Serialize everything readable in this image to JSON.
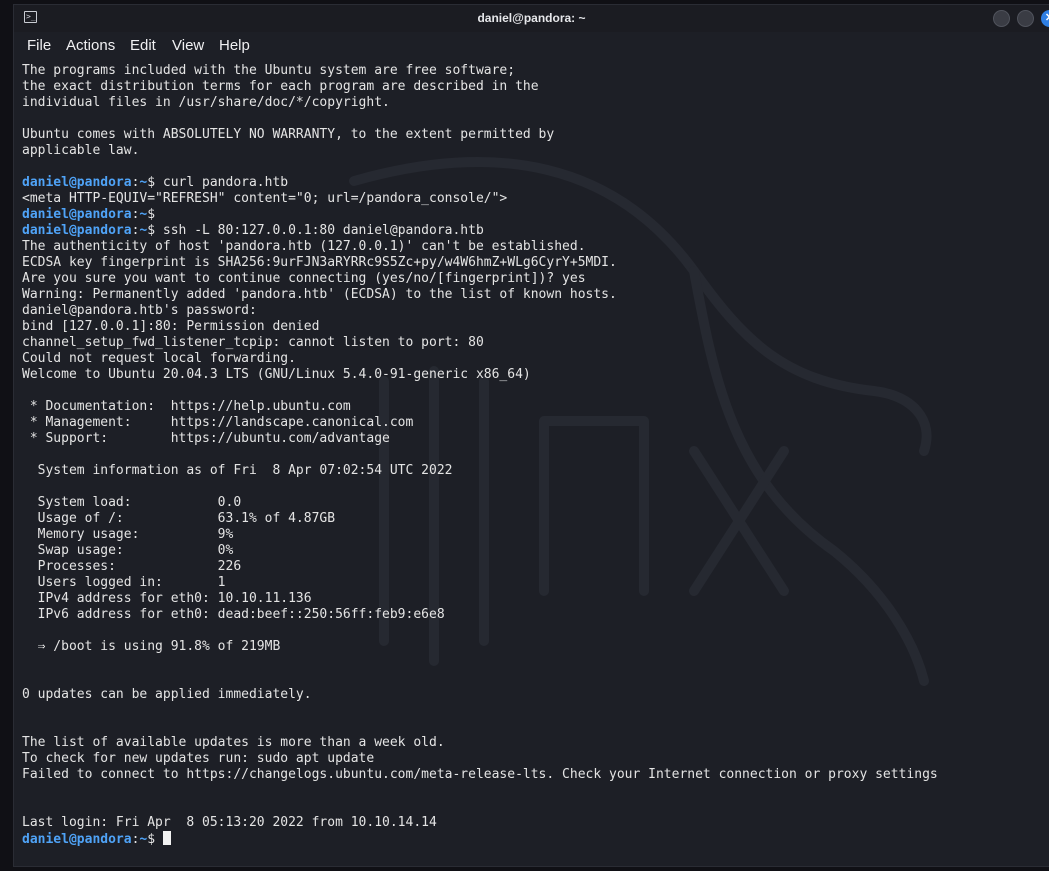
{
  "window": {
    "title": "daniel@pandora: ~",
    "app_icon": "terminal-icon",
    "close_glyph": "✕"
  },
  "menu": [
    "File",
    "Actions",
    "Edit",
    "View",
    "Help"
  ],
  "prompt": {
    "user_host": "daniel@pandora",
    "separator": ":",
    "path": "~",
    "symbol": "$"
  },
  "terminal_lines": [
    {
      "type": "text",
      "text": "The programs included with the Ubuntu system are free software;"
    },
    {
      "type": "text",
      "text": "the exact distribution terms for each program are described in the"
    },
    {
      "type": "text",
      "text": "individual files in /usr/share/doc/*/copyright."
    },
    {
      "type": "text",
      "text": ""
    },
    {
      "type": "text",
      "text": "Ubuntu comes with ABSOLUTELY NO WARRANTY, to the extent permitted by"
    },
    {
      "type": "text",
      "text": "applicable law."
    },
    {
      "type": "text",
      "text": ""
    },
    {
      "type": "cmd",
      "text": " curl pandora.htb"
    },
    {
      "type": "text",
      "text": "<meta HTTP-EQUIV=\"REFRESH\" content=\"0; url=/pandora_console/\">"
    },
    {
      "type": "cmd",
      "text": ""
    },
    {
      "type": "cmd",
      "text": " ssh -L 80:127.0.0.1:80 daniel@pandora.htb"
    },
    {
      "type": "text",
      "text": "The authenticity of host 'pandora.htb (127.0.0.1)' can't be established."
    },
    {
      "type": "text",
      "text": "ECDSA key fingerprint is SHA256:9urFJN3aRYRRc9S5Zc+py/w4W6hmZ+WLg6CyrY+5MDI."
    },
    {
      "type": "text",
      "text": "Are you sure you want to continue connecting (yes/no/[fingerprint])? yes"
    },
    {
      "type": "text",
      "text": "Warning: Permanently added 'pandora.htb' (ECDSA) to the list of known hosts."
    },
    {
      "type": "text",
      "text": "daniel@pandora.htb's password:"
    },
    {
      "type": "text",
      "text": "bind [127.0.0.1]:80: Permission denied"
    },
    {
      "type": "text",
      "text": "channel_setup_fwd_listener_tcpip: cannot listen to port: 80"
    },
    {
      "type": "text",
      "text": "Could not request local forwarding."
    },
    {
      "type": "text",
      "text": "Welcome to Ubuntu 20.04.3 LTS (GNU/Linux 5.4.0-91-generic x86_64)"
    },
    {
      "type": "text",
      "text": ""
    },
    {
      "type": "text",
      "text": " * Documentation:  https://help.ubuntu.com"
    },
    {
      "type": "text",
      "text": " * Management:     https://landscape.canonical.com"
    },
    {
      "type": "text",
      "text": " * Support:        https://ubuntu.com/advantage"
    },
    {
      "type": "text",
      "text": ""
    },
    {
      "type": "text",
      "text": "  System information as of Fri  8 Apr 07:02:54 UTC 2022"
    },
    {
      "type": "text",
      "text": ""
    },
    {
      "type": "text",
      "text": "  System load:           0.0"
    },
    {
      "type": "text",
      "text": "  Usage of /:            63.1% of 4.87GB"
    },
    {
      "type": "text",
      "text": "  Memory usage:          9%"
    },
    {
      "type": "text",
      "text": "  Swap usage:            0%"
    },
    {
      "type": "text",
      "text": "  Processes:             226"
    },
    {
      "type": "text",
      "text": "  Users logged in:       1"
    },
    {
      "type": "text",
      "text": "  IPv4 address for eth0: 10.10.11.136"
    },
    {
      "type": "text",
      "text": "  IPv6 address for eth0: dead:beef::250:56ff:feb9:e6e8"
    },
    {
      "type": "text",
      "text": ""
    },
    {
      "type": "text",
      "text": "  ⇒ /boot is using 91.8% of 219MB"
    },
    {
      "type": "text",
      "text": ""
    },
    {
      "type": "text",
      "text": ""
    },
    {
      "type": "text",
      "text": "0 updates can be applied immediately."
    },
    {
      "type": "text",
      "text": ""
    },
    {
      "type": "text",
      "text": ""
    },
    {
      "type": "text",
      "text": "The list of available updates is more than a week old."
    },
    {
      "type": "text",
      "text": "To check for new updates run: sudo apt update"
    },
    {
      "type": "text",
      "text": "Failed to connect to https://changelogs.ubuntu.com/meta-release-lts. Check your Internet connection or proxy settings"
    },
    {
      "type": "text",
      "text": ""
    },
    {
      "type": "text",
      "text": ""
    },
    {
      "type": "text",
      "text": "Last login: Fri Apr  8 05:13:20 2022 from 10.10.14.14"
    },
    {
      "type": "cmd",
      "text": " ",
      "cursor": true
    }
  ],
  "colors": {
    "background": "#1d1f26",
    "prompt": "#4fa3f7",
    "text": "#e4e4e4",
    "close_button": "#2f7fe3"
  }
}
